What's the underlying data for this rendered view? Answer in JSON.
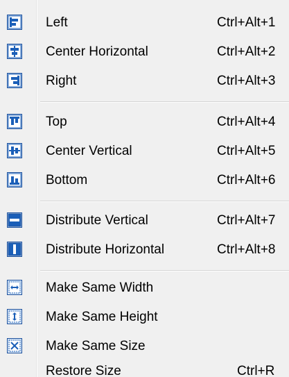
{
  "menu": {
    "items": [
      {
        "label": "Left",
        "shortcut": "Ctrl+Alt+1",
        "icon": "align-left-icon"
      },
      {
        "label": "Center Horizontal",
        "shortcut": "Ctrl+Alt+2",
        "icon": "align-center-horizontal-icon"
      },
      {
        "label": "Right",
        "shortcut": "Ctrl+Alt+3",
        "icon": "align-right-icon"
      },
      {
        "label": "Top",
        "shortcut": "Ctrl+Alt+4",
        "icon": "align-top-icon"
      },
      {
        "label": "Center Vertical",
        "shortcut": "Ctrl+Alt+5",
        "icon": "align-center-vertical-icon"
      },
      {
        "label": "Bottom",
        "shortcut": "Ctrl+Alt+6",
        "icon": "align-bottom-icon"
      },
      {
        "label": "Distribute Vertical",
        "shortcut": "Ctrl+Alt+7",
        "icon": "distribute-vertical-icon"
      },
      {
        "label": "Distribute Horizontal",
        "shortcut": "Ctrl+Alt+8",
        "icon": "distribute-horizontal-icon"
      },
      {
        "label": "Make Same Width",
        "shortcut": "",
        "icon": "same-width-icon"
      },
      {
        "label": "Make Same Height",
        "shortcut": "",
        "icon": "same-height-icon"
      },
      {
        "label": "Make Same Size",
        "shortcut": "",
        "icon": "same-size-icon"
      },
      {
        "label": "Restore Size",
        "shortcut": "Ctrl+R",
        "icon": ""
      }
    ]
  },
  "colors": {
    "icon_blue": "#1b5fb8",
    "icon_border": "#1a4f9c",
    "icon_light": "#dbe8f7"
  }
}
